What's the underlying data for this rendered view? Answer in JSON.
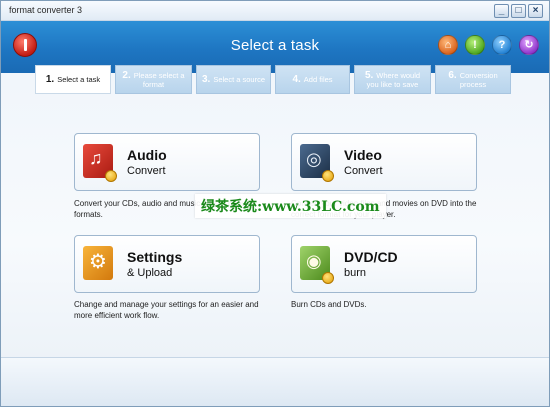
{
  "window": {
    "title": "format converter 3"
  },
  "header": {
    "title": "Select a task"
  },
  "steps": [
    {
      "num": "1.",
      "label": "Select a task",
      "active": true
    },
    {
      "num": "2.",
      "label": "Please select a format",
      "active": false
    },
    {
      "num": "3.",
      "label": "Select a source",
      "active": false
    },
    {
      "num": "4.",
      "label": "Add files",
      "active": false
    },
    {
      "num": "5.",
      "label": "Where would you like to save",
      "active": false
    },
    {
      "num": "6.",
      "label": "Conversion process",
      "active": false
    }
  ],
  "tasks": {
    "audio": {
      "title": "Audio",
      "subtitle": "Convert",
      "desc": "Convert your CDs, audio and music files to popular formats."
    },
    "video": {
      "title": "Video",
      "subtitle": "Convert",
      "desc": "Convert your video files and movies on DVD into the correct format for your player."
    },
    "settings": {
      "title": "Settings",
      "subtitle": "& Upload",
      "desc": "Change and manage your settings for an easier and more efficient work flow."
    },
    "dvd": {
      "title": "DVD/CD",
      "subtitle": "burn",
      "desc": "Burn CDs and DVDs."
    }
  },
  "watermark": "绿茶系统:www.33LC.com"
}
